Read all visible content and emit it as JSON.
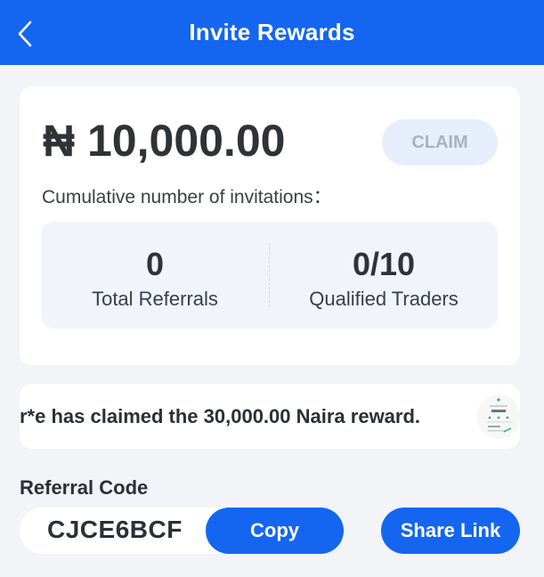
{
  "header": {
    "title": "Invite Rewards",
    "back_icon": "chevron-left-icon"
  },
  "reward": {
    "amount": "₦ 10,000.00",
    "claim_label": "CLAIM",
    "cumulative_label": "Cumulative number of invitations："
  },
  "stats": [
    {
      "value": "0",
      "label": "Total Referrals"
    },
    {
      "value": "0/10",
      "label": "Qualified Traders"
    }
  ],
  "ticker": {
    "message": "r*e has claimed the 30,000.00 Naira reward."
  },
  "referral": {
    "label": "Referral Code",
    "code": "CJCE6BCF",
    "copy_label": "Copy",
    "share_label": "Share Link"
  },
  "colors": {
    "primary": "#1466f0",
    "background": "#f2f4f8",
    "claim_bg": "#e6eefb"
  }
}
